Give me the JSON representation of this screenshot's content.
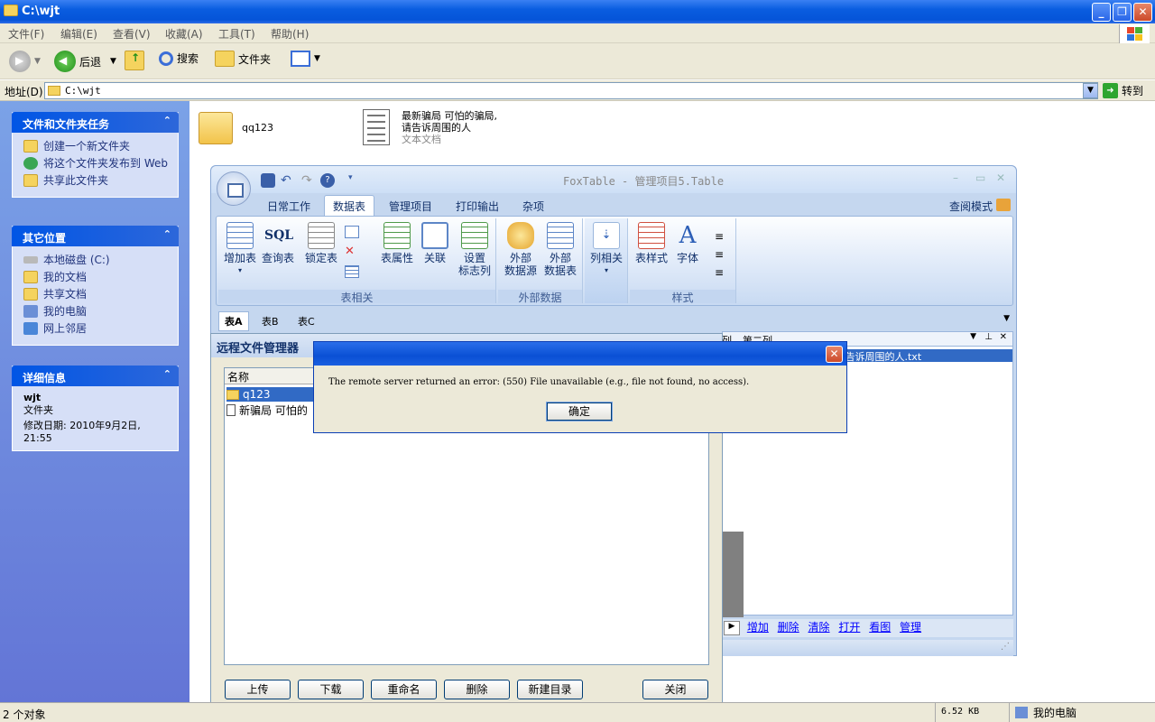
{
  "window": {
    "title": "C:\\wjt"
  },
  "menu": [
    "文件(F)",
    "编辑(E)",
    "查看(V)",
    "收藏(A)",
    "工具(T)",
    "帮助(H)"
  ],
  "toolbar": {
    "back": "后退",
    "search": "搜索",
    "folders": "文件夹"
  },
  "address": {
    "label": "地址(D)",
    "value": "C:\\wjt",
    "go": "转到"
  },
  "tasks": {
    "title": "文件和文件夹任务",
    "items": [
      "创建一个新文件夹",
      "将这个文件夹发布到 Web",
      "共享此文件夹"
    ]
  },
  "places": {
    "title": "其它位置",
    "items": [
      "本地磁盘 (C:)",
      "我的文档",
      "共享文档",
      "我的电脑",
      "网上邻居"
    ]
  },
  "details": {
    "title": "详细信息",
    "name": "wjt",
    "type": "文件夹",
    "modified": "修改日期: 2010年9月2日, 21:55"
  },
  "files": [
    {
      "name": "qq123"
    },
    {
      "name": "最新骗局 可怕的骗局,请告诉周围的人",
      "type": "文本文档"
    }
  ],
  "status": {
    "count": "2 个对象",
    "size": "6.52 KB",
    "location": "我的电脑"
  },
  "foxtable": {
    "title": "FoxTable - 管理项目5.Table",
    "tabs": [
      "日常工作",
      "数据表",
      "管理项目",
      "打印输出",
      "杂项"
    ],
    "active_tab": "数据表",
    "mode": "查阅模式",
    "buttons": {
      "add_table": "增加表",
      "query_table": "查询表",
      "lock_table": "锁定表",
      "table_props": "表属性",
      "relation": "关联",
      "set_flag": "设置",
      "set_flag_2": "标志列",
      "ext_source": "外部",
      "ext_source_2": "数据源",
      "ext_table": "外部",
      "ext_table_2": "数据表",
      "col_related": "列相关",
      "table_style": "表样式",
      "font": "字体"
    },
    "groups": {
      "table": "表相关",
      "external": "外部数据",
      "style": "样式"
    },
    "sheets": [
      "表A",
      "表B",
      "表C"
    ],
    "grid": {
      "col1": "二列",
      "col2": "第二列",
      "selected_cell": "局,请告诉周围的人.txt"
    },
    "links": [
      "增加",
      "删除",
      "清除",
      "打开",
      "看图",
      "管理"
    ]
  },
  "rfm": {
    "title": "远程文件管理器",
    "col": "名称",
    "rows": [
      "q123",
      "新骗局  可怕的"
    ],
    "buttons": [
      "上传",
      "下载",
      "重命名",
      "删除",
      "新建目录",
      "关闭"
    ]
  },
  "error": {
    "message": "The remote server returned an error: (550) File unavailable (e.g., file not found, no access).",
    "ok": "确定"
  }
}
